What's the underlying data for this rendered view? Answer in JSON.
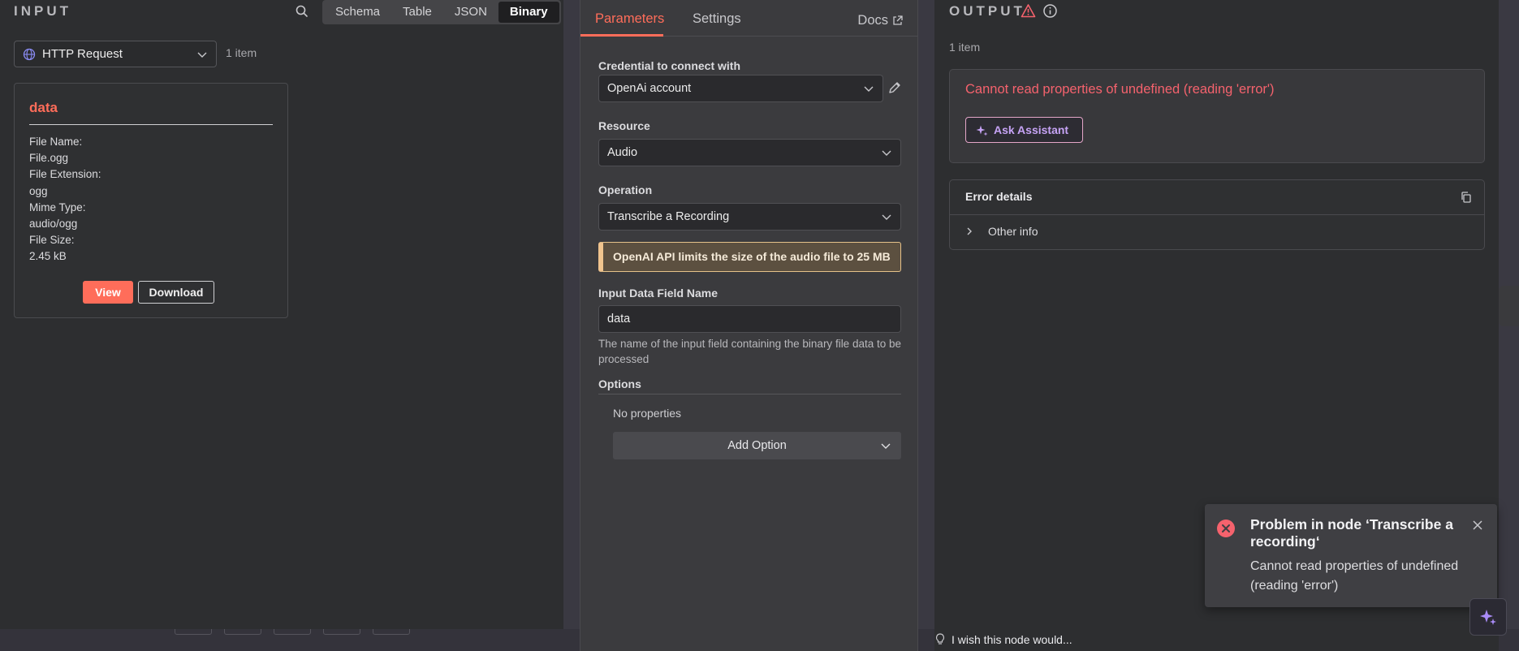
{
  "input_panel": {
    "title": "INPUT",
    "view_tabs": [
      "Schema",
      "Table",
      "JSON",
      "Binary"
    ],
    "active_tab": "Binary",
    "source_node": "HTTP Request",
    "item_count": "1 item",
    "binary": {
      "property": "data",
      "file_name_label": "File Name:",
      "file_name": "File.ogg",
      "file_extension_label": "File Extension:",
      "file_extension": "ogg",
      "mime_type_label": "Mime Type:",
      "mime_type": "audio/ogg",
      "file_size_label": "File Size:",
      "file_size": "2.45 kB",
      "view_label": "View",
      "download_label": "Download"
    }
  },
  "params_panel": {
    "tabs": [
      "Parameters",
      "Settings"
    ],
    "docs_label": "Docs",
    "credential_label": "Credential to connect with",
    "credential_value": "OpenAi account",
    "resource_label": "Resource",
    "resource_value": "Audio",
    "operation_label": "Operation",
    "operation_value": "Transcribe a Recording",
    "notice": "OpenAI API limits the size of the audio file to 25 MB",
    "input_field_label": "Input Data Field Name",
    "input_field_value": "data",
    "input_field_hint": "The name of the input field containing the binary file data to be processed",
    "options_label": "Options",
    "no_properties": "No properties",
    "add_option_label": "Add Option"
  },
  "output_panel": {
    "title": "OUTPUT",
    "item_count": "1 item",
    "error_message": "Cannot read properties of undefined (reading 'error')",
    "ask_assistant_label": "Ask Assistant",
    "error_details_label": "Error details",
    "other_info_label": "Other info"
  },
  "toast": {
    "title": "Problem in node ‘Transcribe a recording‘",
    "body": "Cannot read properties of undefined (reading 'error')"
  },
  "wish_label": "I wish this node would...",
  "colors": {
    "accent": "#ff6d5a",
    "error": "#f5626d",
    "assistant": "#c6a3f5",
    "warning_border": "#f0c48e"
  }
}
